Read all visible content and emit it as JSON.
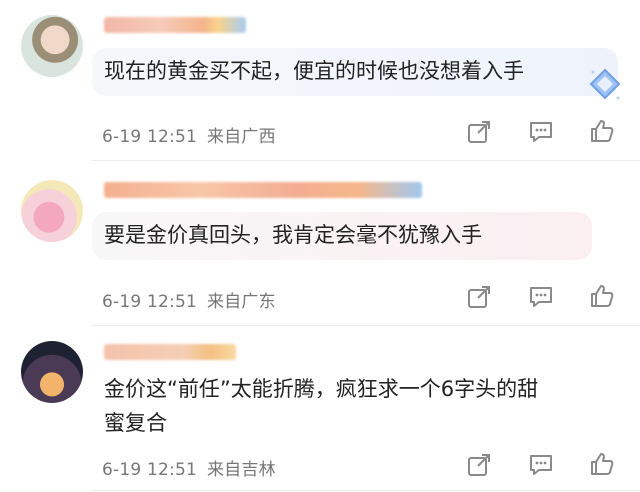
{
  "comments": [
    {
      "text": "现在的黄金买不起，便宜的时候也没想着入手",
      "date": "6-19 12:51",
      "location": "来自广西"
    },
    {
      "text": "要是金价真回头，我肯定会毫不犹豫入手",
      "date": "6-19 12:51",
      "location": "来自广东"
    },
    {
      "text_line1": "金价这“前任”太能折腾，疯狂求一个6字头的甜",
      "text_line2": "蜜复合",
      "date": "6-19 12:51",
      "location": "来自吉林"
    }
  ],
  "icons": {
    "share": "share-icon",
    "comment": "comment-icon",
    "like": "thumbs-up-icon",
    "decoration": "diamond-sticker-icon"
  },
  "colors": {
    "meta_text": "#777777",
    "icon_stroke": "#8a8a8a"
  }
}
